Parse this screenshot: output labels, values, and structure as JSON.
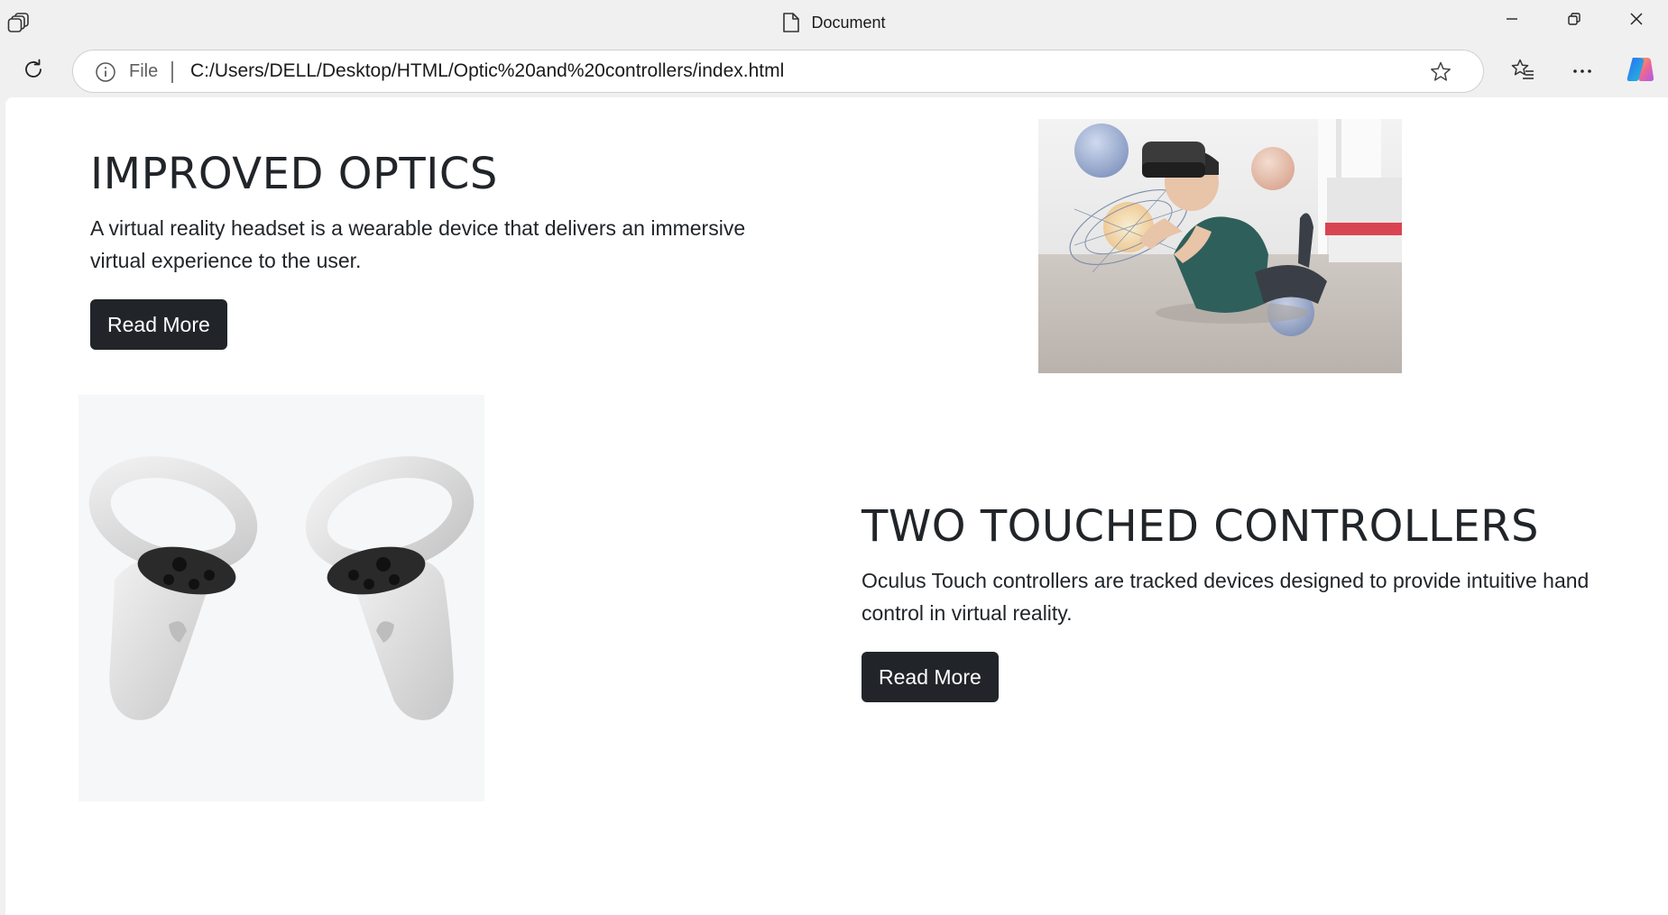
{
  "window": {
    "title": "Document",
    "icons": {
      "app": "tab-actions-icon",
      "doc": "document-icon",
      "minimize": "minimize-icon",
      "maximize": "restore-icon",
      "close": "close-icon"
    }
  },
  "toolbar": {
    "file_label": "File",
    "url": "C:/Users/DELL/Desktop/HTML/Optic%20and%20controllers/index.html",
    "icons": {
      "reload": "reload-icon",
      "info": "info-icon",
      "favorite": "star-icon",
      "favorites": "favorites-icon",
      "menu": "more-icon",
      "copilot": "copilot-icon"
    }
  },
  "content": {
    "optics": {
      "heading": "IMPROVED OPTICS",
      "description": "A virtual reality headset is a wearable device that delivers an immersive virtual experience to the user.",
      "button": "Read More"
    },
    "controllers": {
      "heading": "TWO TOUCHED CONTROLLERS",
      "description": "Oculus Touch controllers are tracked devices designed to provide intuitive hand control in virtual reality.",
      "button": "Read More"
    }
  },
  "colors": {
    "button_bg": "#212529",
    "text": "#212529",
    "chrome_bg": "#f0f0f0"
  }
}
